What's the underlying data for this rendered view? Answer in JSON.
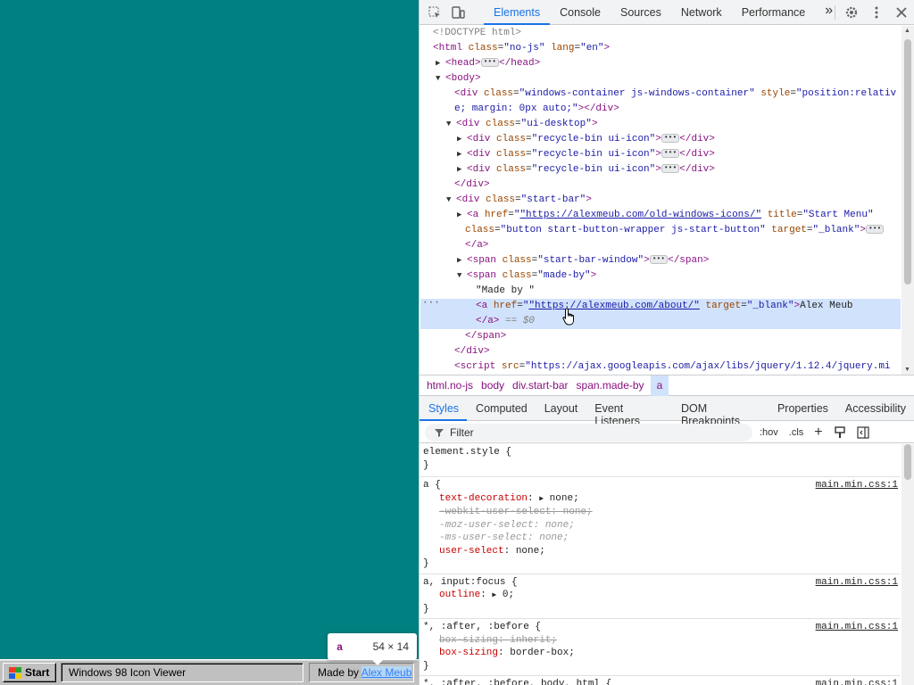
{
  "desktop": {
    "background": "#008080"
  },
  "taskbar": {
    "start_label": "Start",
    "window_label": "Windows 98 Icon Viewer",
    "tray_prefix": "Made by ",
    "tray_link": "Alex Meub"
  },
  "tooltip": {
    "tag": "a",
    "size": "54 × 14"
  },
  "devtools": {
    "tabs": [
      "Elements",
      "Console",
      "Sources",
      "Network",
      "Performance"
    ],
    "more": "»",
    "dom": {
      "doctype": "<!DOCTYPE html>",
      "html_open_tag": "<html",
      "html_attr1": "class",
      "html_val1": "\"no-js\"",
      "html_attr2": "lang",
      "html_val2": "\"en\"",
      "head": "<head>",
      "head_close": "</head>",
      "body": "<body>",
      "div_wc_open": "<div",
      "div_wc_class": "\"windows-container js-windows-container\"",
      "div_wc_style1": "\"position:relativ",
      "div_wc_style2": "e; margin: 0px auto;\"",
      "div_close": "></div>",
      "ui_desktop": "\"ui-desktop\"",
      "recycle": "\"recycle-bin ui-icon\"",
      "end_div": "</div>",
      "start_bar": "\"start-bar\"",
      "a_href1": "\"https://alexmeub.com/old-windows-icons/\"",
      "a_title": "\"Start Menu\"",
      "a_class": "\"button start-button-wrapper js-start-button\"",
      "a_target": "\"_blank\"",
      "a_close": "</a>",
      "span_sbw": "\"start-bar-window\"",
      "span_close": "</span>",
      "span_made": "\"made-by\"",
      "text_made": "\"Made by \"",
      "a_href2": "\"https://alexmeub.com/about/\"",
      "a_text": "Alex Meub",
      "eq": "== $0",
      "body_close": "</div>",
      "script_src": "\"https://ajax.googleapis.com/ajax/libs/jquery/1.12.4/jquery.mi"
    },
    "breadcrumbs": [
      "html.no-js",
      "body",
      "div.start-bar",
      "span.made-by",
      "a"
    ],
    "sub_tabs": [
      "Styles",
      "Computed",
      "Layout",
      "Event Listeners",
      "DOM Breakpoints",
      "Properties",
      "Accessibility"
    ],
    "filter_placeholder": "Filter",
    "filter_tools": [
      ":hov",
      ".cls"
    ],
    "styles": {
      "r1_sel": "element.style {",
      "close": "}",
      "r2_sel": "a {",
      "r2_src": "main.min.css:1",
      "r2_d1p": "text-decoration",
      "r2_d1v": "none;",
      "r2_d2": "-webkit-user-select: none;",
      "r2_d3": "-moz-user-select: none;",
      "r2_d4": "-ms-user-select: none;",
      "r2_d5p": "user-select",
      "r2_d5v": "none;",
      "r3_sel": "a, input:focus {",
      "r3_src": "main.min.css:1",
      "r3_d1p": "outline",
      "r3_d1v": "0;",
      "r4_sel": "*, :after, :before {",
      "r4_src": "main.min.css:1",
      "r4_d1": "box-sizing: inherit;",
      "r4_d2p": "box-sizing",
      "r4_d2v": "border-box;",
      "r5_sel": "*, :after, :before, body, html {",
      "r5_src": "main.min.css:1"
    }
  }
}
